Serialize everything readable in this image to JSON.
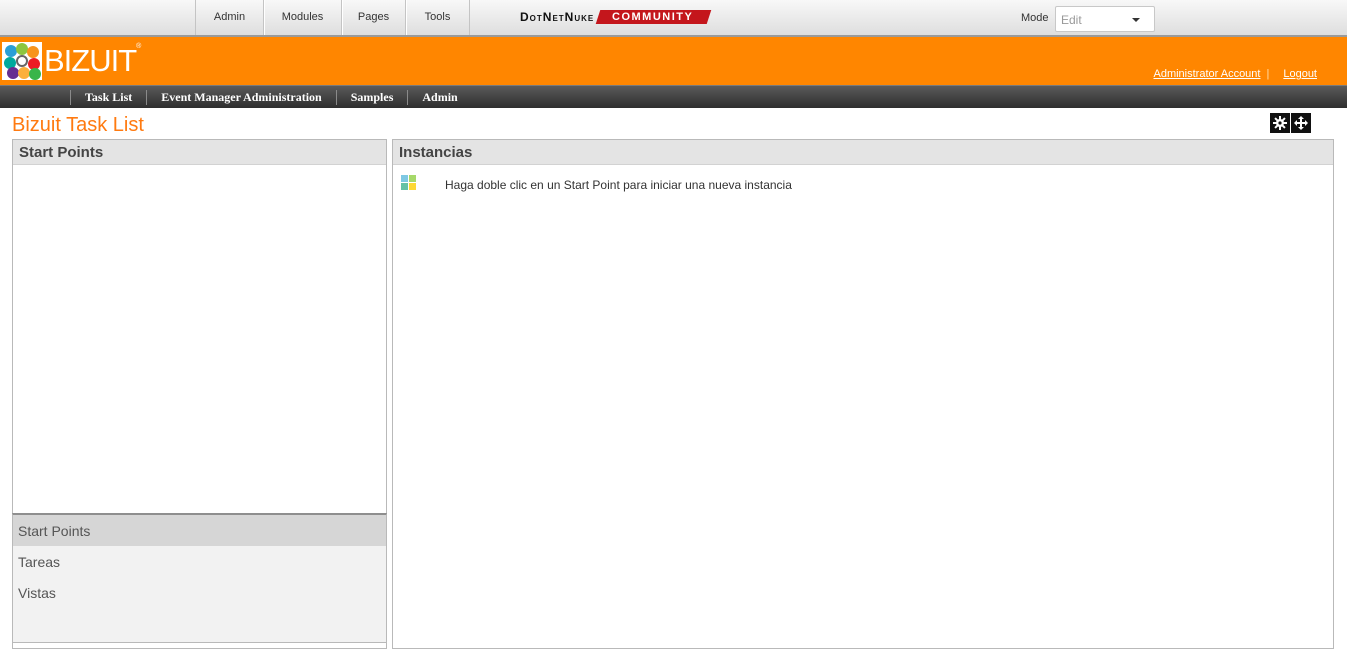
{
  "control_bar": {
    "menu": [
      "Admin",
      "Modules",
      "Pages",
      "Tools"
    ],
    "brand_dnn": "DotNetNuke",
    "brand_community": "COMMUNITY",
    "mode_label": "Mode",
    "mode_value": "Edit"
  },
  "banner": {
    "logo_text": "BIZUIT",
    "logo_mark": "®",
    "account_link": "Administrator Account",
    "separator": "|",
    "logout_link": "Logout"
  },
  "nav": {
    "items": [
      "Task List",
      "Event Manager Administration",
      "Samples",
      "Admin"
    ]
  },
  "page": {
    "title": "Bizuit Task List"
  },
  "left_panel": {
    "header": "Start Points",
    "bottom_items": [
      "Start Points",
      "Tareas",
      "Vistas"
    ]
  },
  "right_panel": {
    "header": "Instancias",
    "hint": "Haga doble clic en un Start Point para iniciar una nueva instancia"
  },
  "icons": {
    "tools": [
      "gear-icon",
      "move-icon"
    ],
    "instance": "start-point-icon"
  },
  "colors": {
    "banner": "#ff8600",
    "title": "#ff7a10",
    "nav": "#3a3a3a",
    "community_badge": "#c4161c"
  }
}
